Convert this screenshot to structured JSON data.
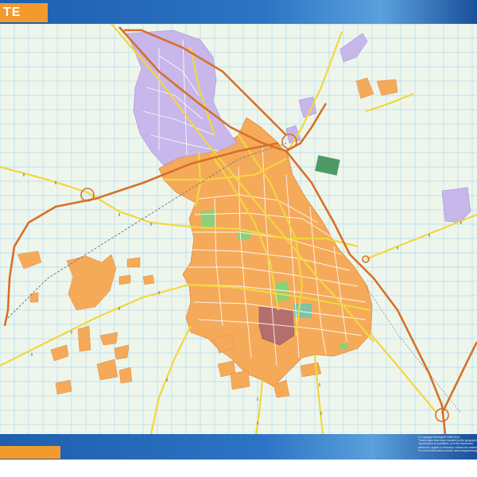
{
  "title": "TE",
  "copyright_lines": [
    "© Copyright Netmaps® 1989-2014",
    "These maps have been created by the geographic",
    "reproduction is prohibited, or in the framework",
    "electronic, digital or mechanic, without the written",
    "For more information consult: www.mapasnetmaps"
  ],
  "colors": {
    "background": "#eef6ec",
    "grid": "#b5d9ee",
    "urban": "#f5aa5a",
    "urban_outline": "#e08a3c",
    "industrial": "#c8b7ea",
    "park": "#8fcf78",
    "facility_green": "#4e9a66",
    "facility_teal": "#7cc3a7",
    "hospital": "#b56e6e",
    "motorway": "#d7702a",
    "main_road": "#f2d73d",
    "header": "#2868b8",
    "accent": "#f39a2f"
  },
  "icons": [
    "motorway-junction-icon"
  ]
}
